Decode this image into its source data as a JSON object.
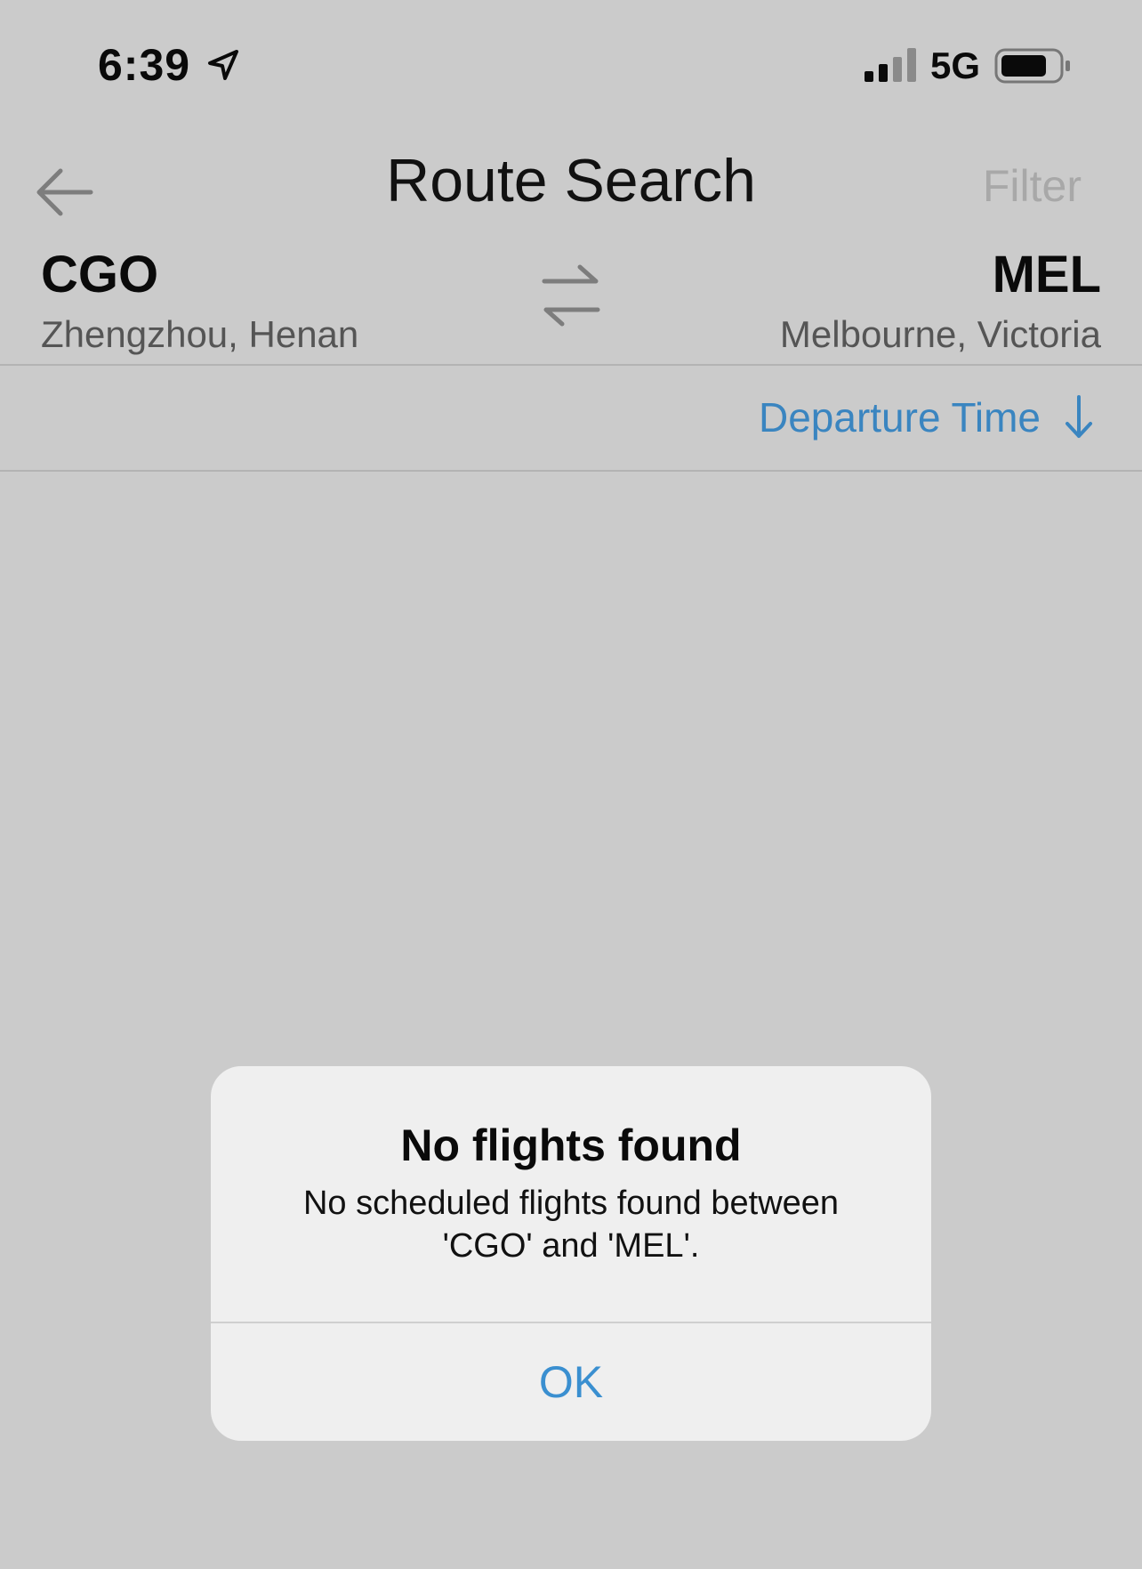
{
  "status_bar": {
    "time": "6:39",
    "network": "5G",
    "signal_bars": 2,
    "signal_bars_max": 4
  },
  "nav": {
    "title": "Route Search",
    "filter_label": "Filter",
    "back_icon": "arrow-left-icon"
  },
  "route": {
    "origin": {
      "code": "CGO",
      "city": "Zhengzhou, Henan"
    },
    "destination": {
      "code": "MEL",
      "city": "Melbourne, Victoria"
    },
    "swap_icon": "swap-arrows-icon"
  },
  "sort": {
    "label": "Departure Time",
    "direction_icon": "arrow-down-icon"
  },
  "alert": {
    "title": "No flights found",
    "message_line1": "No scheduled flights found between",
    "message_line2": "'CGO' and 'MEL'.",
    "ok_label": "OK"
  },
  "colors": {
    "background": "#cbcbcb",
    "accent": "#3a85c0",
    "alert_background": "#efefef"
  }
}
